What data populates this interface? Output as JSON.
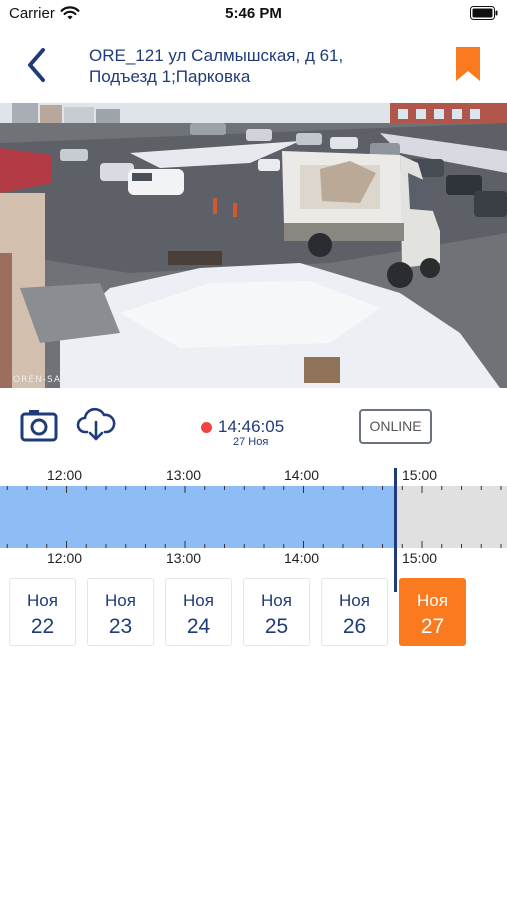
{
  "status_bar": {
    "carrier": "Carrier",
    "time": "5:46 PM"
  },
  "header": {
    "title_line1": "ORE_121 ул Салмышская, д 61,",
    "title_line2": "Подъезд 1;Парковка",
    "accent_color": "#f97a1f"
  },
  "camera": {
    "watermark": "OREN-SAL"
  },
  "controls": {
    "current_time": "14:46:05",
    "current_date": "27 Ноя",
    "online_label": "ONLINE",
    "live_dot_color": "#ee4444"
  },
  "timeline": {
    "top_labels": [
      "12:00",
      "13:00",
      "14:00",
      "15:00"
    ],
    "bottom_labels": [
      "12:00",
      "13:00",
      "14:00",
      "15:00"
    ],
    "recorded_color": "#8ebcf5",
    "empty_color": "#e0e0e0"
  },
  "dates": [
    {
      "month": "Ноя",
      "day": "22",
      "selected": false
    },
    {
      "month": "Ноя",
      "day": "23",
      "selected": false
    },
    {
      "month": "Ноя",
      "day": "24",
      "selected": false
    },
    {
      "month": "Ноя",
      "day": "25",
      "selected": false
    },
    {
      "month": "Ноя",
      "day": "26",
      "selected": false
    },
    {
      "month": "Ноя",
      "day": "27",
      "selected": true
    }
  ]
}
